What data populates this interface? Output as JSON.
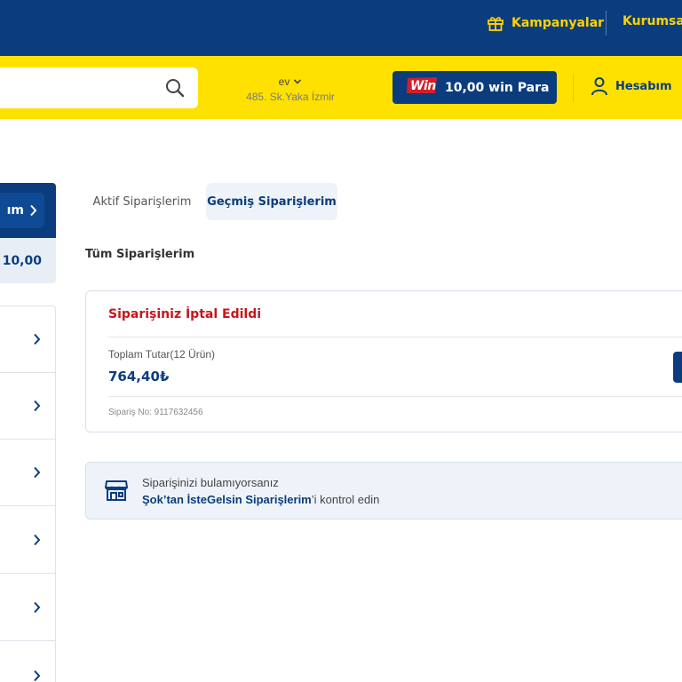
{
  "topbar": {
    "campaigns_label": "Kampanyalar",
    "corporate_label": "Kurumsal"
  },
  "header": {
    "search_placeholder": "",
    "address_name": "ev",
    "address_line": "485. Sk.Yaka İzmir",
    "win_logo": "Win",
    "win_balance": "10,00 win Para",
    "account_label": "Hesabım"
  },
  "sidebar": {
    "account_button_label": "ım",
    "balance": "10,00",
    "item_count": 6
  },
  "tabs": {
    "active_orders": "Aktif Siparişlerim",
    "past_orders": "Geçmiş Siparişlerim"
  },
  "section_title": "Tüm Siparişlerim",
  "order": {
    "status": "Siparişiniz İptal Edildi",
    "total_label": "Toplam Tutar(12 Ürün)",
    "total_value": "764,40₺",
    "order_no": "Sipariş No: 9117632456"
  },
  "info": {
    "line1": "Siparişinizi bulamıyorsanız",
    "link_text": "Şok’tan İsteGelsin Siparişlerim",
    "line2_suffix": "’i kontrol edin"
  },
  "colors": {
    "navy": "#0b3d7e",
    "yellow": "#ffe100",
    "status_red": "#c8151b"
  }
}
